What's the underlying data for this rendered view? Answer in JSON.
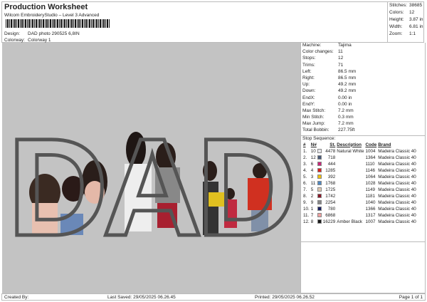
{
  "header": {
    "title": "Production Worksheet",
    "subtitle": "Wilcom EmbroideryStudio – Level 3 Advanced",
    "design_label": "Design:",
    "design": "DAD photo 290525 6,8IN",
    "colorway_label": "Colorway:",
    "colorway": "Colorway 1"
  },
  "stats": [
    {
      "k": "Stitches:",
      "v": "38685"
    },
    {
      "k": "Colors:",
      "v": "12"
    },
    {
      "k": "Height:",
      "v": "3.87 in"
    },
    {
      "k": "Width:",
      "v": "6.81 in"
    },
    {
      "k": "Zoom:",
      "v": "1:1"
    }
  ],
  "design_text": "DAD",
  "info": [
    {
      "k": "Machine:",
      "v": "Tajima"
    },
    {
      "k": "Color changes:",
      "v": "11"
    },
    {
      "k": "Stops:",
      "v": "12"
    },
    {
      "k": "Trims:",
      "v": "71"
    },
    {
      "k": "Left:",
      "v": "86.5 mm"
    },
    {
      "k": "Right:",
      "v": "86.5 mm"
    },
    {
      "k": "Up:",
      "v": "49.2 mm"
    },
    {
      "k": "Down:",
      "v": "49.2 mm"
    },
    {
      "k": "EndX:",
      "v": "0.00 in"
    },
    {
      "k": "EndY:",
      "v": "0.00 in"
    },
    {
      "k": "Max Stitch:",
      "v": "7.2 mm"
    },
    {
      "k": "Min Stitch:",
      "v": "0.3 mm"
    },
    {
      "k": "Max Jump:",
      "v": "7.2 mm"
    },
    {
      "k": "Total Bobbin:",
      "v": "227.75ft"
    }
  ],
  "stop_sequence": {
    "title": "Stop Sequence:",
    "headers": [
      "#",
      "N#",
      "St.",
      "Description",
      "Code",
      "Brand"
    ],
    "rows": [
      {
        "i": "1.",
        "n": "10",
        "c": "#e8e8ec",
        "st": "4478",
        "d": "Natural White",
        "code": "1004",
        "b": "Madeira Classic 40"
      },
      {
        "i": "2.",
        "n": "12",
        "c": "#4a5a78",
        "st": "718",
        "d": "",
        "code": "1364",
        "b": "Madeira Classic 40"
      },
      {
        "i": "3.",
        "n": "6",
        "c": "#c8287a",
        "st": "444",
        "d": "",
        "code": "1110",
        "b": "Madeira Classic 40"
      },
      {
        "i": "4.",
        "n": "4",
        "c": "#d82020",
        "st": "1285",
        "d": "",
        "code": "1146",
        "b": "Madeira Classic 40"
      },
      {
        "i": "5.",
        "n": "3",
        "c": "#f0c010",
        "st": "392",
        "d": "",
        "code": "1064",
        "b": "Madeira Classic 40"
      },
      {
        "i": "6.",
        "n": "11",
        "c": "#5088c0",
        "st": "1768",
        "d": "",
        "code": "1028",
        "b": "Madeira Classic 40"
      },
      {
        "i": "7.",
        "n": "5",
        "c": "#e0c8b0",
        "st": "1725",
        "d": "",
        "code": "1149",
        "b": "Madeira Classic 40"
      },
      {
        "i": "8.",
        "n": "2",
        "c": "#8a1828",
        "st": "1742",
        "d": "",
        "code": "1181",
        "b": "Madeira Classic 40"
      },
      {
        "i": "9.",
        "n": "9",
        "c": "#888888",
        "st": "2254",
        "d": "",
        "code": "1040",
        "b": "Madeira Classic 40"
      },
      {
        "i": "10.",
        "n": "1",
        "c": "#1a2060",
        "st": "780",
        "d": "",
        "code": "1366",
        "b": "Madeira Classic 40"
      },
      {
        "i": "11.",
        "n": "7",
        "c": "#f0a0a0",
        "st": "6868",
        "d": "",
        "code": "1317",
        "b": "Madeira Classic 40"
      },
      {
        "i": "12.",
        "n": "8",
        "c": "#1a1a1a",
        "st": "16229",
        "d": "Amber Black",
        "code": "1007",
        "b": "Madeira Classic 40"
      }
    ]
  },
  "footer": {
    "created": "Created By:",
    "saved": "Last Saved: 29/05/2025 06.26.45",
    "printed": "Printed: 29/05/2025 06.26.52",
    "page": "Page 1 of 1"
  }
}
